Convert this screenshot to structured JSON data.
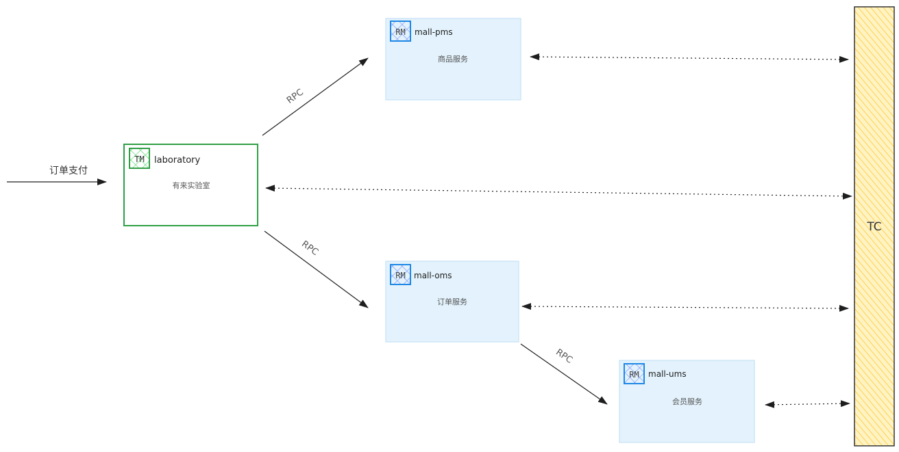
{
  "colors": {
    "tm_stroke": "#2f9e44",
    "rm_stroke": "#1e88e5",
    "rm_fill": "#e3f2fc",
    "tc_fill": "#ffd97a",
    "line": "#1e1e1e"
  },
  "entry": {
    "label": "订单支付"
  },
  "tm": {
    "badge": "TM",
    "name": "laboratory",
    "desc": "有来实验室"
  },
  "rms": [
    {
      "badge": "RM",
      "name": "mall-pms",
      "desc": "商品服务"
    },
    {
      "badge": "RM",
      "name": "mall-oms",
      "desc": "订单服务"
    },
    {
      "badge": "RM",
      "name": "mall-ums",
      "desc": "会员服务"
    }
  ],
  "rpc_labels": [
    "RPC",
    "RPC",
    "RPC"
  ],
  "tc": {
    "label": "TC"
  }
}
